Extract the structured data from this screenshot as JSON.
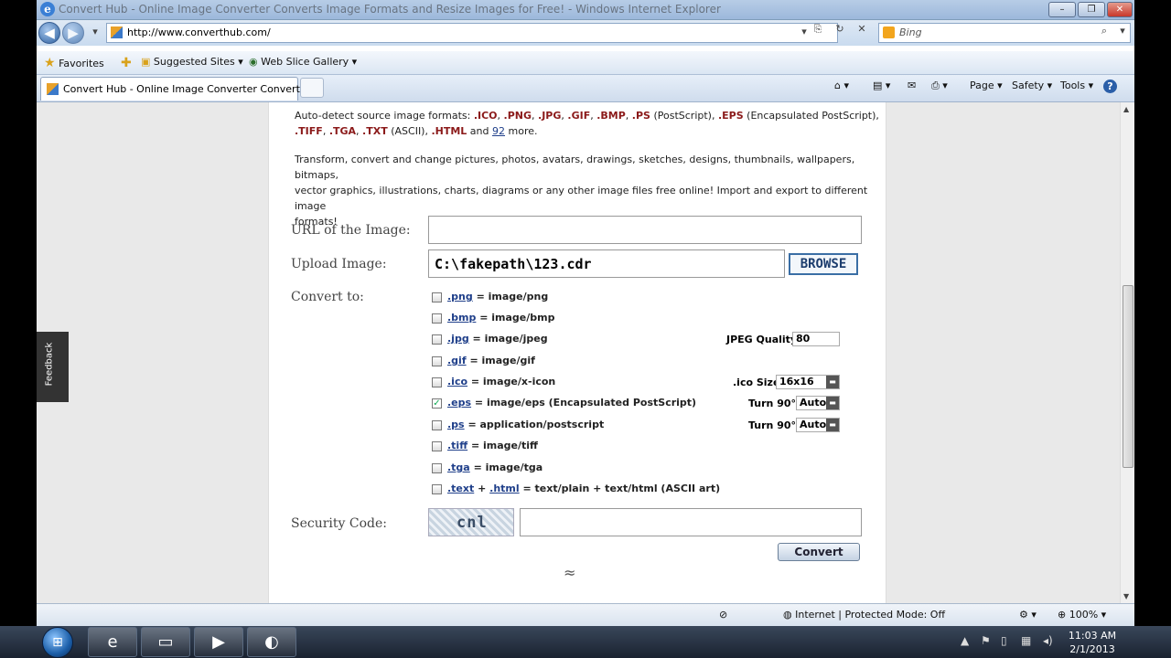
{
  "window": {
    "title": "Convert Hub - Online Image Converter Converts Image Formats and Resize Images for Free! - Windows Internet Explorer",
    "min": "–",
    "max": "❐",
    "close": "✕"
  },
  "address": {
    "url": "http://www.converthub.com/",
    "search_placeholder": "Bing"
  },
  "favorites": {
    "label": "Favorites",
    "suggested": "Suggested Sites ▾",
    "webslice": "Web Slice Gallery ▾"
  },
  "tab": {
    "label": "Convert Hub - Online Image Converter Converts ..."
  },
  "commands": {
    "page": "Page ▾",
    "safety": "Safety ▾",
    "tools": "Tools ▾",
    "help": "?"
  },
  "feedback": "Feedback",
  "intro": {
    "p1_lead": "Auto-detect source image formats: ",
    "ico": ".ICO",
    "png": ".PNG",
    "jpg": ".JPG",
    "gif": ".GIF",
    "bmp": ".BMP",
    "ps": ".PS",
    "ps_note": " (PostScript), ",
    "eps": ".EPS",
    "eps_note": " (Encapsulated PostScript),",
    "tiff": ".TIFF",
    "tga": ".TGA",
    "txt": ".TXT",
    "txt_note": " (ASCII), ",
    "html": ".HTML",
    "and": " and ",
    "count": "92",
    "more": " more.",
    "p2_line1": "Transform, convert and change pictures, photos, avatars, drawings, sketches, designs, thumbnails, wallpapers, bitmaps,",
    "p2_line2": "vector graphics, illustrations, charts, diagrams or any other image files free online! Import and export to different image",
    "p2_line3": "formats!"
  },
  "form": {
    "url_label": "URL of the Image:",
    "upload_label": "Upload Image:",
    "upload_value": "C:\\fakepath\\123.cdr",
    "browse": "BROWSE",
    "convert_label": "Convert to:",
    "options": [
      {
        "ext": ".png",
        "desc": " = image/png",
        "checked": false
      },
      {
        "ext": ".bmp",
        "desc": " = image/bmp",
        "checked": false
      },
      {
        "ext": ".jpg",
        "desc": " = image/jpeg",
        "checked": false
      },
      {
        "ext": ".gif",
        "desc": " = image/gif",
        "checked": false
      },
      {
        "ext": ".ico",
        "desc": " = image/x-icon",
        "checked": false
      },
      {
        "ext": ".eps",
        "desc": " = image/eps (Encapsulated PostScript)",
        "checked": true
      },
      {
        "ext": ".ps",
        "desc": " = application/postscript",
        "checked": false
      },
      {
        "ext": ".tiff",
        "desc": " = image/tiff",
        "checked": false
      },
      {
        "ext": ".tga",
        "desc": " = image/tga",
        "checked": false
      },
      {
        "ext": ".text",
        "plus": " + ",
        "ext2": ".html",
        "desc": " = text/plain + text/html (ASCII art)",
        "checked": false
      }
    ],
    "jpeg_quality_label": "JPEG Quality:",
    "jpeg_quality": "80",
    "ico_size_label": ".ico Size:",
    "ico_size": "16x16",
    "turn_label": "Turn 90°:",
    "turn_eps": "Auto",
    "turn_ps": "Auto",
    "security_label": "Security Code:",
    "captcha_text": "cnl",
    "convert": "Convert",
    "squiggle": "≈"
  },
  "status": {
    "zone": "Internet | Protected Mode: Off",
    "zoom": "100%"
  },
  "taskbar": {
    "time": "11:03 AM",
    "date": "2/1/2013"
  }
}
